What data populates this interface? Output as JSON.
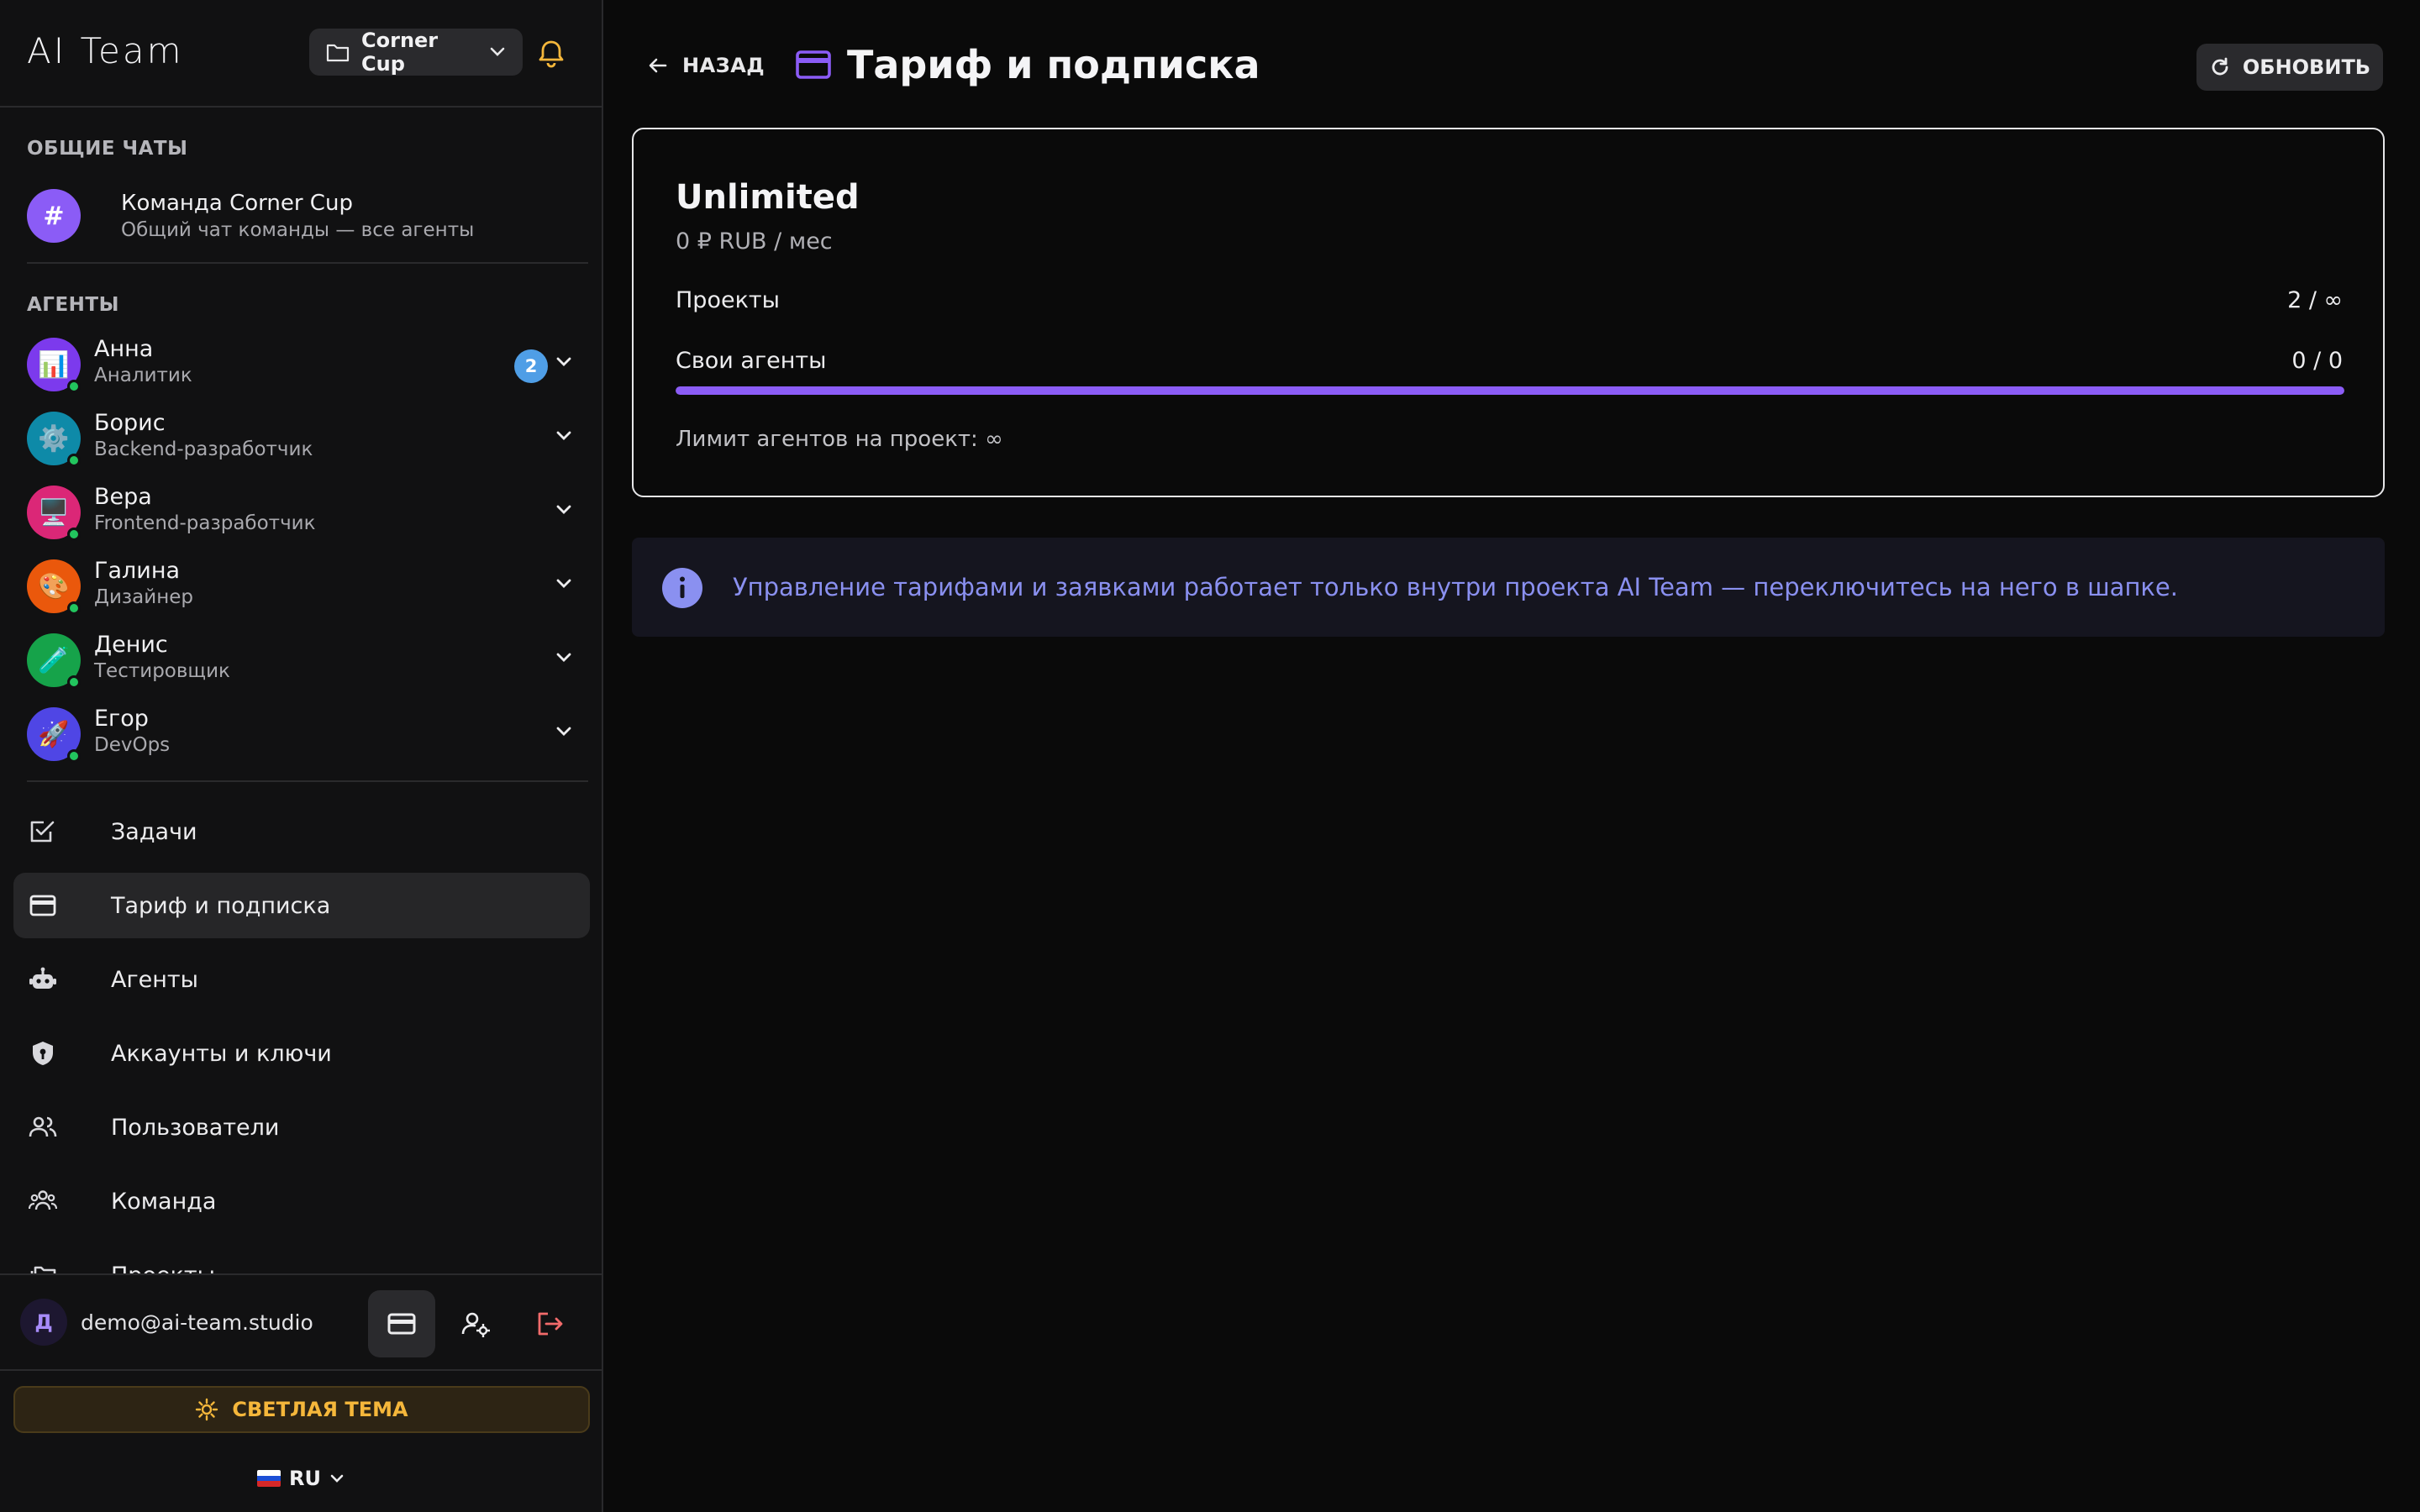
{
  "app": {
    "title": "AI Team"
  },
  "project": {
    "name": "Corner Cup"
  },
  "sidebar": {
    "general_chats_title": "ОБЩИЕ ЧАТЫ",
    "team_chat": {
      "symbol": "#",
      "name": "Команда Corner Cup",
      "subtitle": "Общий чат команды — все агенты"
    },
    "agents_title": "АГЕНТЫ",
    "agents": [
      {
        "name": "Анна",
        "role": "Аналитик",
        "icon": "📊",
        "color": "#7c3aed",
        "badge": "2"
      },
      {
        "name": "Борис",
        "role": "Backend-разработчик",
        "icon": "⚙️",
        "color": "#0e8aa8"
      },
      {
        "name": "Вера",
        "role": "Frontend-разработчик",
        "icon": "🖥️",
        "color": "#db2777"
      },
      {
        "name": "Галина",
        "role": "Дизайнер",
        "icon": "🎨",
        "color": "#ea580c"
      },
      {
        "name": "Денис",
        "role": "Тестировщик",
        "icon": "🧪",
        "color": "#16a34a"
      },
      {
        "name": "Егор",
        "role": "DevOps",
        "icon": "🚀",
        "color": "#4f46e5"
      }
    ],
    "nav": [
      {
        "label": "Задачи",
        "icon": "check-square-icon"
      },
      {
        "label": "Тариф и подписка",
        "icon": "credit-card-icon",
        "active": true
      },
      {
        "label": "Агенты",
        "icon": "robot-icon"
      },
      {
        "label": "Аккаунты и ключи",
        "icon": "shield-key-icon"
      },
      {
        "label": "Пользователи",
        "icon": "users-icon"
      },
      {
        "label": "Команда",
        "icon": "team-icon"
      },
      {
        "label": "Проекты",
        "icon": "folders-icon"
      }
    ]
  },
  "user": {
    "initial": "Д",
    "email": "demo@ai-team.studio"
  },
  "theme_button": {
    "label": "СВЕТЛАЯ ТЕМА"
  },
  "language": {
    "code": "RU"
  },
  "header": {
    "back_label": "НАЗАД",
    "title": "Тариф и подписка",
    "refresh_label": "ОБНОВИТЬ"
  },
  "plan": {
    "name": "Unlimited",
    "price": "0 ₽ RUB / мес",
    "projects_label": "Проекты",
    "projects_value": "2 / ∞",
    "agents_label": "Свои агенты",
    "agents_value": "0 / 0",
    "agents_progress": 1.0,
    "limit_text": "Лимит агентов на проект: ∞"
  },
  "info": {
    "text": "Управление тарифами и заявками работает только внутри проекта AI Team — переключитесь на него в шапке."
  },
  "colors": {
    "accent": "#8b5cf6",
    "warning": "#f5b73b",
    "info": "#8a90f0",
    "danger": "#f26b6b"
  }
}
